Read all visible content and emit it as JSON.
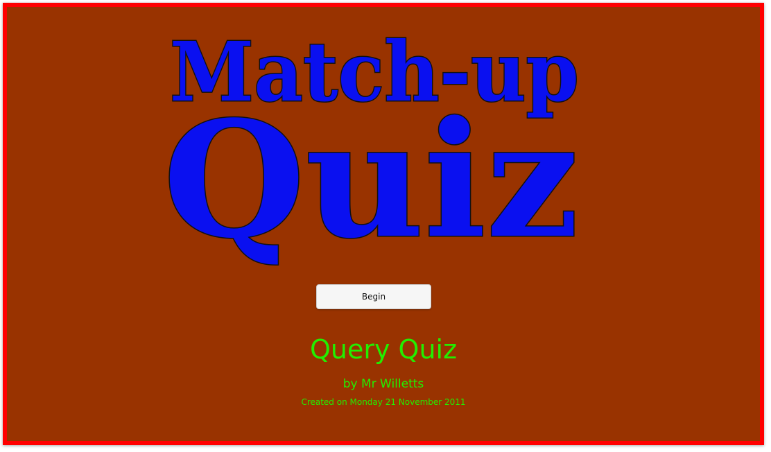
{
  "logo": {
    "line1": "Match-up",
    "line2": "Quiz"
  },
  "begin_label": "Begin",
  "quiz_title": "Query Quiz",
  "author": "by Mr Willetts",
  "created": "Created on Monday 21 November 2011",
  "colors": {
    "background": "#993300",
    "border": "#ff0000",
    "logo": "#0a10f0",
    "text": "#22ee00"
  }
}
